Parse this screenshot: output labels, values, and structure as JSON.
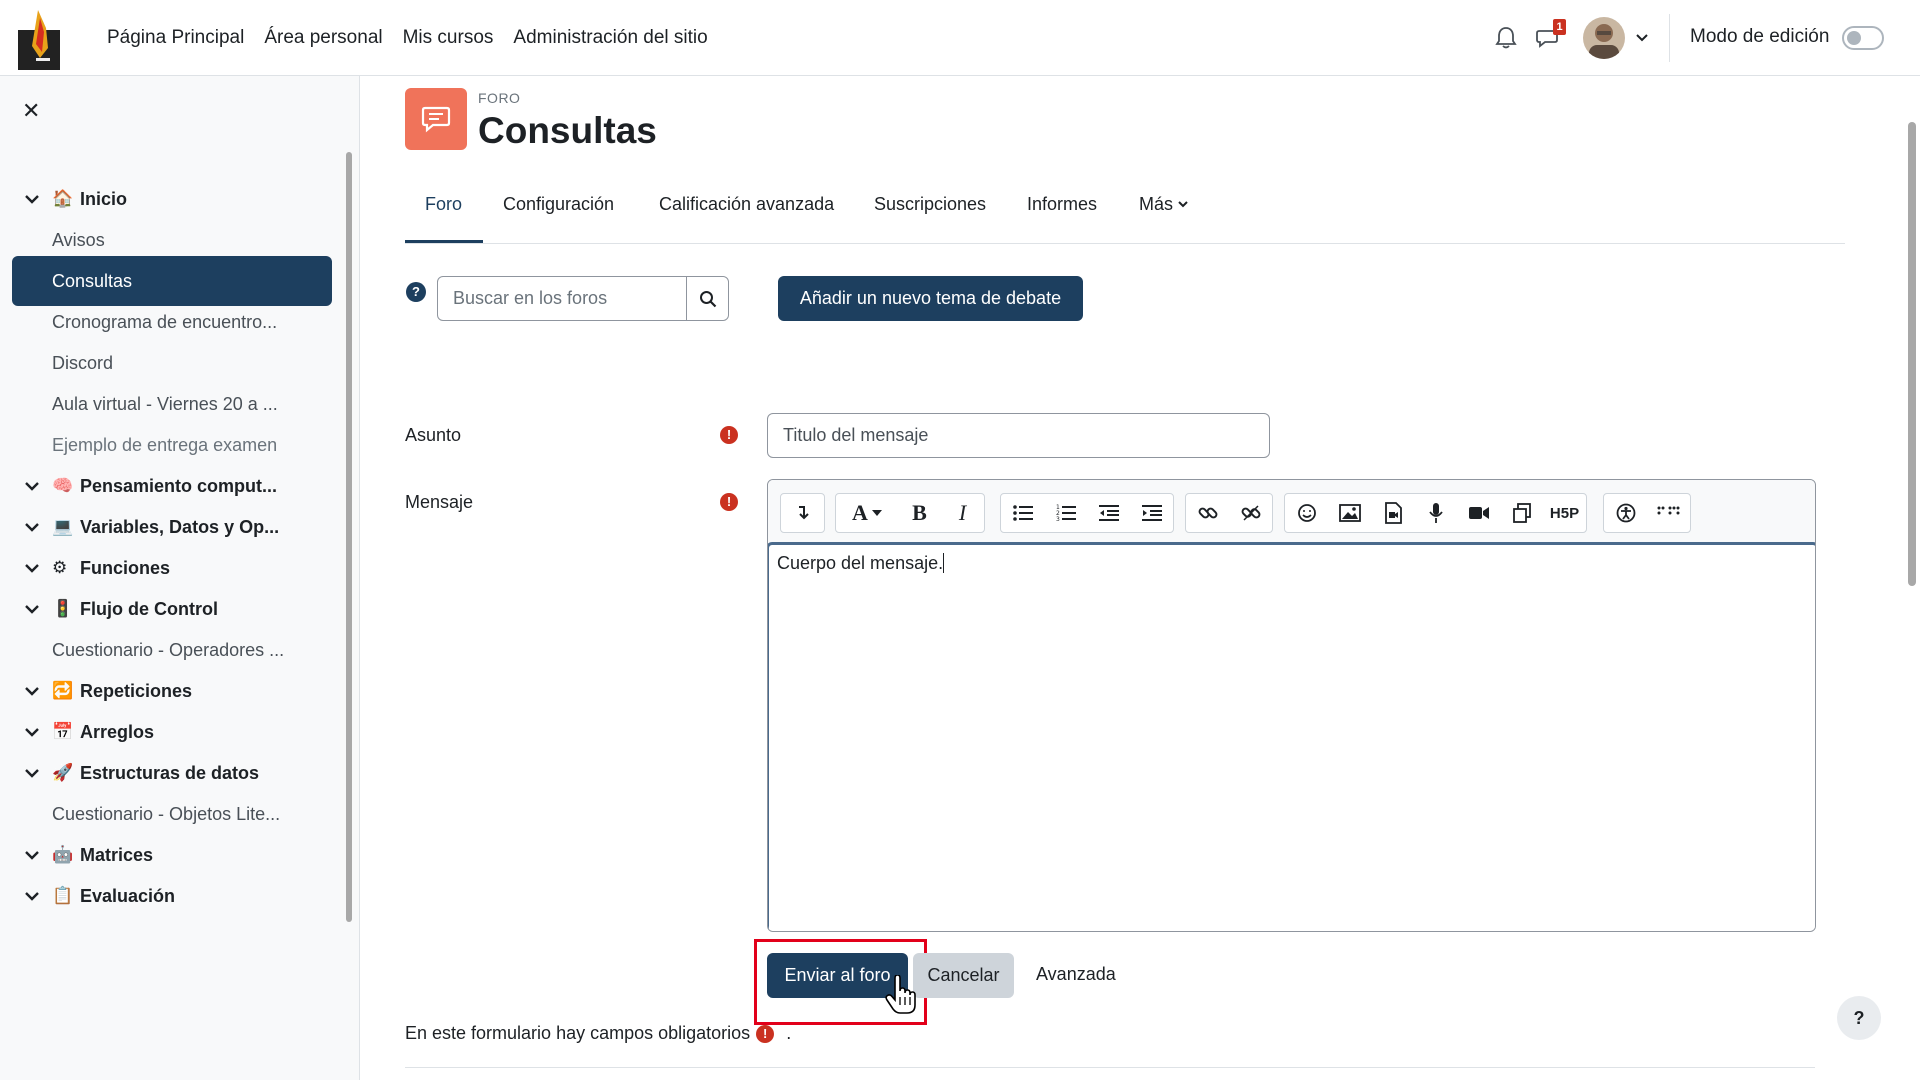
{
  "navbar": {
    "links": [
      "Página Principal",
      "Área personal",
      "Mis cursos",
      "Administración del sitio"
    ],
    "notification_count": "1",
    "edit_mode_label": "Modo de edición"
  },
  "drawer": {
    "items": [
      {
        "label": "Inicio",
        "type": "section",
        "emoji": "🏠"
      },
      {
        "label": "Avisos",
        "type": "child"
      },
      {
        "label": "Consultas",
        "type": "child-active"
      },
      {
        "label": "Cronograma de encuentro...",
        "type": "child"
      },
      {
        "label": "Discord",
        "type": "child"
      },
      {
        "label": "Aula virtual - Viernes 20 a ...",
        "type": "child"
      },
      {
        "label": "Ejemplo de entrega examen",
        "type": "child-muted"
      },
      {
        "label": "Pensamiento comput...",
        "type": "section",
        "emoji": "🧠"
      },
      {
        "label": "Variables, Datos y Op...",
        "type": "section",
        "emoji": "💻"
      },
      {
        "label": "Funciones",
        "type": "section",
        "emoji": "⚙"
      },
      {
        "label": "Flujo de Control",
        "type": "section",
        "emoji": "🚦"
      },
      {
        "label": "Cuestionario - Operadores ...",
        "type": "child"
      },
      {
        "label": "Repeticiones",
        "type": "section",
        "emoji": "🔁"
      },
      {
        "label": "Arreglos",
        "type": "section",
        "emoji": "📅"
      },
      {
        "label": "Estructuras de datos",
        "type": "section",
        "emoji": "🚀"
      },
      {
        "label": "Cuestionario - Objetos Lite...",
        "type": "child"
      },
      {
        "label": "Matrices",
        "type": "section",
        "emoji": "🤖"
      },
      {
        "label": "Evaluación",
        "type": "section",
        "emoji": "📋"
      }
    ]
  },
  "page": {
    "module_type": "FORO",
    "title": "Consultas"
  },
  "tabs": [
    "Foro",
    "Configuración",
    "Calificación avanzada",
    "Suscripciones",
    "Informes",
    "Más"
  ],
  "search": {
    "placeholder": "Buscar en los foros"
  },
  "add_topic_label": "Añadir un nuevo tema de debate",
  "form": {
    "subject_label": "Asunto",
    "subject_placeholder": "Titulo del mensaje",
    "message_label": "Mensaje",
    "message_value": "Cuerpo del mensaje.",
    "submit_label": "Enviar al foro",
    "cancel_label": "Cancelar",
    "advanced_label": "Avanzada",
    "required_note": "En este formulario hay campos obligatorios",
    "required_note_end": "."
  },
  "colors": {
    "primary": "#1d3f5f",
    "forum_icon": "#f0735a",
    "required": "#ca3120",
    "highlight": "#e2001a"
  }
}
